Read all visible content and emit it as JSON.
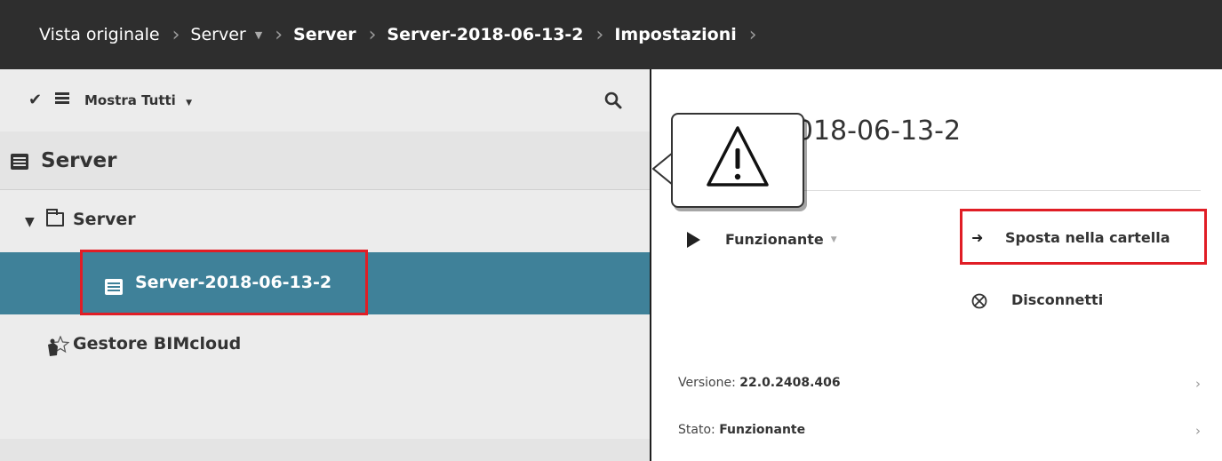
{
  "breadcrumb": {
    "items": [
      {
        "label": "Vista originale"
      },
      {
        "label": "Server"
      },
      {
        "label": "Server"
      },
      {
        "label": "Server-2018-06-13-2"
      },
      {
        "label": "Impostazioni"
      }
    ]
  },
  "toolbar": {
    "filter_label": "Mostra Tutti"
  },
  "tree": {
    "section_title": "Server",
    "folder_label": "Server",
    "selected_item": "Server-2018-06-13-2",
    "manager_label": "Gestore BIMcloud"
  },
  "detail": {
    "title": "Server-2018-06-13-2",
    "visible_title": "rver-2018-06-13-2",
    "status_label": "Funzionante",
    "move_label": "Sposta nella cartella",
    "disconnect_label": "Disconnetti",
    "version_key": "Versione:",
    "version_value": "22.0.2408.406",
    "state_key": "Stato:",
    "state_value": "Funzionante"
  },
  "colors": {
    "topbar": "#2e2e2e",
    "selected_row": "#3f8199",
    "highlight": "#e01d25",
    "panel": "#ececec"
  },
  "icons": [
    "check-icon",
    "list-icon",
    "search-icon",
    "server-icon",
    "folder-icon",
    "manager-icon",
    "play-icon",
    "move-arrow-icon",
    "disconnect-icon",
    "warning-icon",
    "chevron-right-icon"
  ]
}
